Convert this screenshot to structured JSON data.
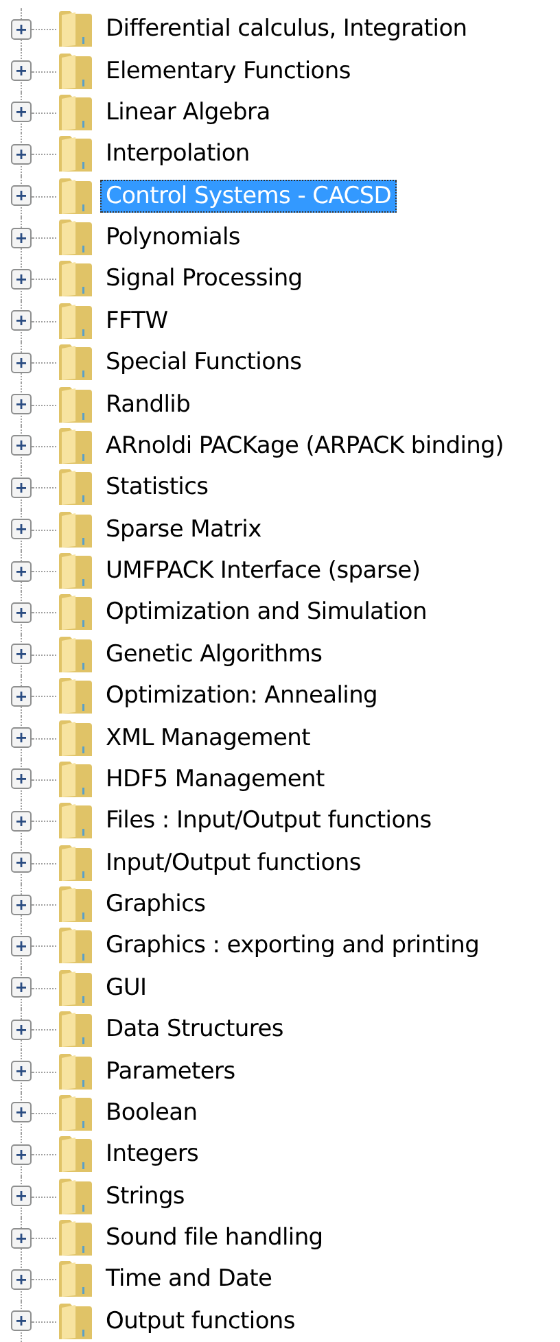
{
  "tree": {
    "items": [
      {
        "label": "Differential calculus, Integration",
        "expanded": false,
        "selected": false
      },
      {
        "label": "Elementary Functions",
        "expanded": false,
        "selected": false
      },
      {
        "label": "Linear Algebra",
        "expanded": false,
        "selected": false
      },
      {
        "label": "Interpolation",
        "expanded": false,
        "selected": false
      },
      {
        "label": "Control Systems - CACSD",
        "expanded": false,
        "selected": true
      },
      {
        "label": "Polynomials",
        "expanded": false,
        "selected": false
      },
      {
        "label": "Signal Processing",
        "expanded": false,
        "selected": false
      },
      {
        "label": "FFTW",
        "expanded": false,
        "selected": false
      },
      {
        "label": "Special Functions",
        "expanded": false,
        "selected": false
      },
      {
        "label": "Randlib",
        "expanded": false,
        "selected": false
      },
      {
        "label": "ARnoldi PACKage (ARPACK binding)",
        "expanded": false,
        "selected": false
      },
      {
        "label": "Statistics",
        "expanded": false,
        "selected": false
      },
      {
        "label": "Sparse Matrix",
        "expanded": false,
        "selected": false
      },
      {
        "label": "UMFPACK Interface (sparse)",
        "expanded": false,
        "selected": false
      },
      {
        "label": "Optimization and Simulation",
        "expanded": false,
        "selected": false
      },
      {
        "label": "Genetic Algorithms",
        "expanded": false,
        "selected": false
      },
      {
        "label": "Optimization: Annealing",
        "expanded": false,
        "selected": false
      },
      {
        "label": "XML Management",
        "expanded": false,
        "selected": false
      },
      {
        "label": "HDF5 Management",
        "expanded": false,
        "selected": false
      },
      {
        "label": "Files : Input/Output functions",
        "expanded": false,
        "selected": false
      },
      {
        "label": "Input/Output functions",
        "expanded": false,
        "selected": false
      },
      {
        "label": "Graphics",
        "expanded": false,
        "selected": false
      },
      {
        "label": "Graphics : exporting and printing",
        "expanded": false,
        "selected": false
      },
      {
        "label": "GUI",
        "expanded": false,
        "selected": false
      },
      {
        "label": "Data Structures",
        "expanded": false,
        "selected": false
      },
      {
        "label": "Parameters",
        "expanded": false,
        "selected": false
      },
      {
        "label": "Boolean",
        "expanded": false,
        "selected": false
      },
      {
        "label": "Integers",
        "expanded": false,
        "selected": false
      },
      {
        "label": "Strings",
        "expanded": false,
        "selected": false
      },
      {
        "label": "Sound file handling",
        "expanded": false,
        "selected": false
      },
      {
        "label": "Time and Date",
        "expanded": false,
        "selected": false
      },
      {
        "label": "Output functions",
        "expanded": false,
        "selected": false
      }
    ]
  }
}
